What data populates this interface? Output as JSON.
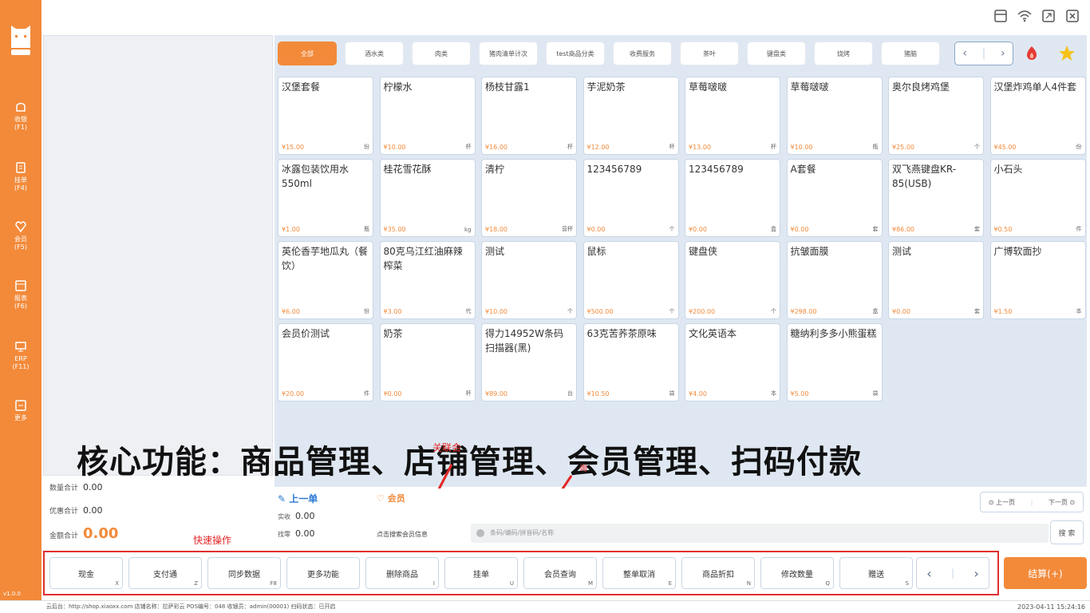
{
  "sidebar": {
    "logo_text": "收银",
    "items": [
      {
        "label": "收银",
        "key": "(F1)",
        "icon": "cashier-icon"
      },
      {
        "label": "挂单",
        "key": "(F4)",
        "icon": "order-icon"
      },
      {
        "label": "会员",
        "key": "(F5)",
        "icon": "member-icon"
      },
      {
        "label": "报表",
        "key": "(F6)",
        "icon": "report-icon"
      },
      {
        "label": "ERP",
        "key": "(F11)",
        "icon": "erp-icon"
      },
      {
        "label": "更多",
        "key": "",
        "icon": "more-icon"
      }
    ],
    "version": "v1.0.0"
  },
  "categories": [
    "全部",
    "酒水类",
    "肉类",
    "猪肉清单计次",
    "test商品分类",
    "收费服务",
    "茶叶",
    "键盘类",
    "烧烤",
    "猪脑"
  ],
  "products": [
    {
      "name": "汉堡套餐",
      "price": "¥15.00",
      "unit": "份"
    },
    {
      "name": "柠檬水",
      "price": "¥10.00",
      "unit": "杯"
    },
    {
      "name": "杨枝甘露1",
      "price": "¥16.00",
      "unit": "杯"
    },
    {
      "name": "芋泥奶茶",
      "price": "¥12.00",
      "unit": "杯"
    },
    {
      "name": "草莓啵啵",
      "price": "¥13.00",
      "unit": "杯"
    },
    {
      "name": "草莓啵啵",
      "price": "¥10.00",
      "unit": "瓶"
    },
    {
      "name": "奥尔良烤鸡堡",
      "price": "¥25.00",
      "unit": "个"
    },
    {
      "name": "汉堡炸鸡单人4件套",
      "price": "¥45.00",
      "unit": "份"
    },
    {
      "name": "冰露包装饮用水550ml",
      "price": "¥1.00",
      "unit": "瓶"
    },
    {
      "name": "桂花雪花酥",
      "price": "¥35.00",
      "unit": "kg"
    },
    {
      "name": "清柠",
      "price": "¥18.00",
      "unit": "营杯"
    },
    {
      "name": "123456789",
      "price": "¥0.00",
      "unit": "个"
    },
    {
      "name": "123456789",
      "price": "¥0.00",
      "unit": "盒"
    },
    {
      "name": "A套餐",
      "price": "¥0.00",
      "unit": "套"
    },
    {
      "name": "双飞燕键盘KR-85(USB)",
      "price": "¥86.00",
      "unit": "套"
    },
    {
      "name": "小石头",
      "price": "¥0.50",
      "unit": "件"
    },
    {
      "name": "英伦香芋地瓜丸（餐饮）",
      "price": "¥6.00",
      "unit": "份"
    },
    {
      "name": "80克乌江红油麻辣榨菜",
      "price": "¥3.00",
      "unit": "代"
    },
    {
      "name": "测试",
      "price": "¥10.00",
      "unit": "个"
    },
    {
      "name": "鼠标",
      "price": "¥500.00",
      "unit": "个"
    },
    {
      "name": "键盘侠",
      "price": "¥200.00",
      "unit": "个"
    },
    {
      "name": "抗皱面膜",
      "price": "¥298.00",
      "unit": "盒"
    },
    {
      "name": "测试",
      "price": "¥0.00",
      "unit": "套"
    },
    {
      "name": "广博软面抄",
      "price": "¥1.50",
      "unit": "本"
    },
    {
      "name": "会员价测试",
      "price": "¥20.00",
      "unit": "件"
    },
    {
      "name": "奶茶",
      "price": "¥0.00",
      "unit": "杯"
    },
    {
      "name": "得力14952W条码扫描器(黑)",
      "price": "¥89.00",
      "unit": "台"
    },
    {
      "name": "63克苦荞茶原味",
      "price": "¥10.50",
      "unit": "袋"
    },
    {
      "name": "文化英语本",
      "price": "¥4.00",
      "unit": "本"
    },
    {
      "name": "糖纳利多多小熊蛋糕",
      "price": "¥5.00",
      "unit": "袋"
    }
  ],
  "totals": {
    "qty_label": "数量合计",
    "qty_value": "0.00",
    "discount_label": "优惠合计",
    "discount_value": "0.00",
    "amount_label": "金额合计",
    "amount_value": "0.00"
  },
  "banner": "核心功能：商品管理、店铺管理、会员管理、扫码付款",
  "annotations": {
    "link_member": "关联会",
    "search_arrow": "询",
    "quick_ops": "快速操作"
  },
  "lower": {
    "prev_order": "上一单",
    "member": "会员",
    "paid_label": "实收",
    "paid_value": "0.00",
    "change_label": "找零",
    "change_value": "0.00",
    "member_hint": "点击搜索会员信息",
    "search_placeholder": "条码/编码/拼音码/名称",
    "search_button": "搜 索",
    "pager_prev": "上一页",
    "pager_next": "下一页"
  },
  "func_buttons": [
    {
      "label": "现金",
      "key": "X"
    },
    {
      "label": "支付通",
      "key": "Z"
    },
    {
      "label": "同步数据",
      "key": "F8"
    },
    {
      "label": "更多功能",
      "key": ""
    },
    {
      "label": "删除商品",
      "key": "I"
    },
    {
      "label": "挂单",
      "key": "U"
    },
    {
      "label": "会员查询",
      "key": "M"
    },
    {
      "label": "整单取消",
      "key": "E"
    },
    {
      "label": "商品折扣",
      "key": "N"
    },
    {
      "label": "修改数量",
      "key": "Q"
    },
    {
      "label": "赠送",
      "key": "S"
    }
  ],
  "checkout_label": "结算(+)",
  "status": {
    "text": "云后台：http://shop.xiaoxx.com  店铺名称：拉萨彩云  POS编号：048  收银员：admin(00001)  扫码状态：已开启",
    "datetime": "2023-04-11 15:24:16"
  },
  "colors": {
    "accent": "#f28a3a",
    "annotation": "#e03030",
    "link": "#2b79d3"
  }
}
